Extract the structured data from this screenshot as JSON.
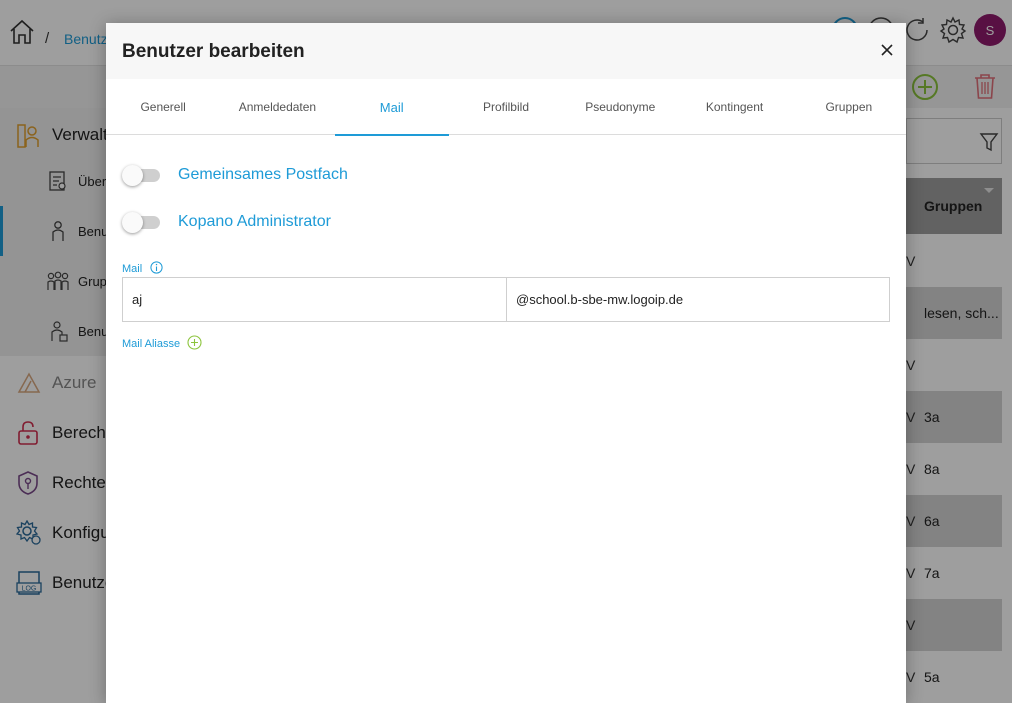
{
  "colors": {
    "accent": "#1e9bd7",
    "avatar": "#8e1a6c",
    "add_green": "#8cc43c",
    "delete_red": "#e0707a"
  },
  "background": {
    "breadcrumb": {
      "home_icon": "home-icon",
      "separator": "/",
      "current": "Benutz"
    },
    "top_icons": [
      "help-icon",
      "info-icon",
      "refresh-icon",
      "gear-icon"
    ],
    "avatar_initial": "S",
    "toolbar_icons": [
      "add-circle-icon",
      "trash-icon"
    ],
    "sidebar": [
      {
        "label": "Verwalt",
        "icon": "users-admin-icon"
      },
      {
        "label": "Über",
        "icon": "overview-icon"
      },
      {
        "label": "Benu",
        "icon": "user-icon"
      },
      {
        "label": "Grup",
        "icon": "group-icon"
      },
      {
        "label": "Benu",
        "icon": "user-lock-icon"
      },
      {
        "label": "Azure",
        "icon": "azure-icon"
      },
      {
        "label": "Berecht",
        "icon": "lock-open-icon"
      },
      {
        "label": "Rechtev",
        "icon": "shield-key-icon"
      },
      {
        "label": "Konfigu",
        "icon": "gear-config-icon"
      },
      {
        "label": "Benutze",
        "icon": "log-icon"
      }
    ],
    "filter_icon": "filter-icon",
    "table": {
      "column_header": "Gruppen",
      "rows": [
        {
          "mark": "V",
          "value": ""
        },
        {
          "mark": "",
          "value": "lesen, sch..."
        },
        {
          "mark": "V",
          "value": ""
        },
        {
          "mark": "V",
          "value": "3a"
        },
        {
          "mark": "V",
          "value": "8a"
        },
        {
          "mark": "V",
          "value": "6a"
        },
        {
          "mark": "V",
          "value": "7a"
        },
        {
          "mark": "V",
          "value": ""
        },
        {
          "mark": "V",
          "value": "5a"
        }
      ]
    }
  },
  "modal": {
    "title": "Benutzer bearbeiten",
    "close_icon": "close-icon",
    "tabs": [
      {
        "label": "Generell",
        "active": false
      },
      {
        "label": "Anmeldedaten",
        "active": false
      },
      {
        "label": "Mail",
        "active": true
      },
      {
        "label": "Profilbild",
        "active": false
      },
      {
        "label": "Pseudonyme",
        "active": false
      },
      {
        "label": "Kontingent",
        "active": false
      },
      {
        "label": "Gruppen",
        "active": false
      }
    ],
    "toggles": [
      {
        "label": "Gemeinsames Postfach",
        "on": false
      },
      {
        "label": "Kopano Administrator",
        "on": false
      }
    ],
    "mail": {
      "label": "Mail",
      "local_part": "aj",
      "domain": "@school.b-sbe-mw.logoip.de"
    },
    "aliases_label": "Mail Aliasse"
  }
}
